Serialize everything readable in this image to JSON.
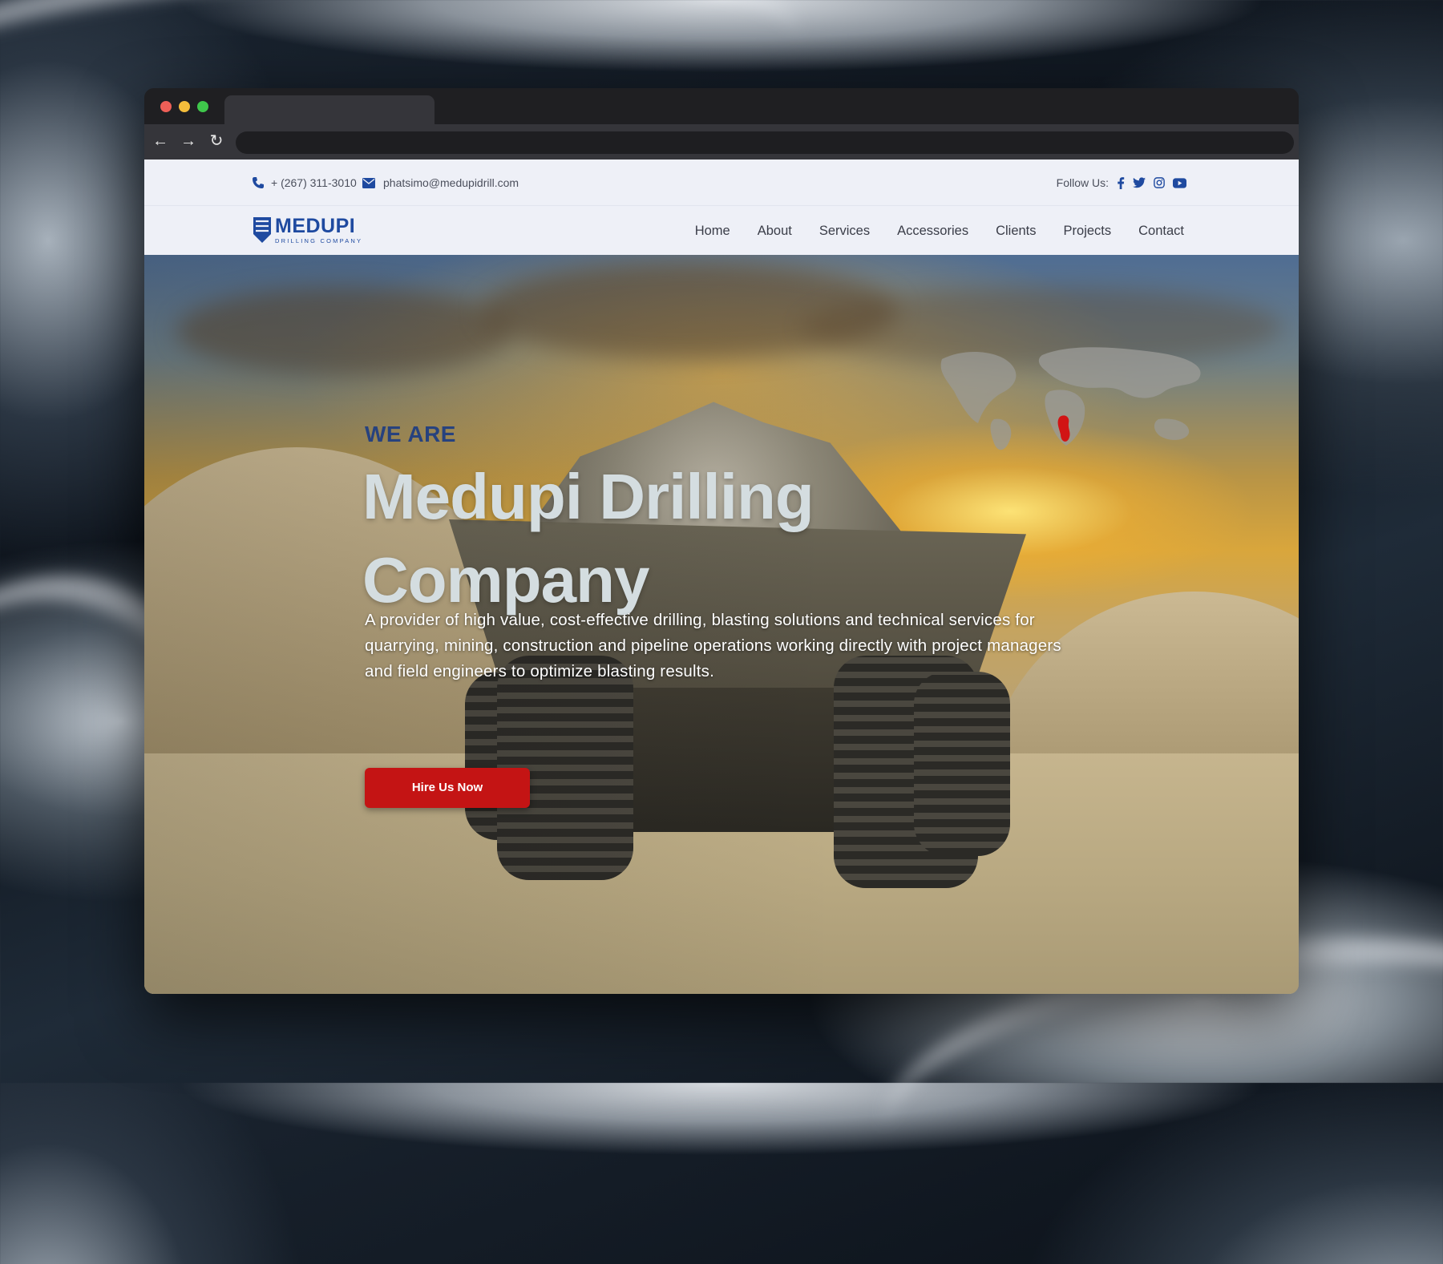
{
  "browser": {
    "back": "←",
    "forward": "→",
    "reload": "↻"
  },
  "contact": {
    "phone": "+ (267) 311-3010",
    "email": "phatsimo@medupidrill.com"
  },
  "social": {
    "label": "Follow Us:",
    "icons": [
      "facebook-icon",
      "twitter-icon",
      "instagram-icon",
      "youtube-icon"
    ]
  },
  "brand": {
    "name": "MEDUPI",
    "tagline": "DRILLING COMPANY",
    "color": "#1f4aa0"
  },
  "nav": {
    "items": [
      "Home",
      "About",
      "Services",
      "Accessories",
      "Clients",
      "Projects",
      "Contact"
    ]
  },
  "hero": {
    "eyebrow": "WE ARE",
    "title_line1": "Medupi Drilling",
    "title_line2": "Company",
    "description": "A provider of high value, cost-effective drilling, blasting solutions and technical services for quarrying, mining, construction and pipeline operations working directly with project managers and field engineers to optimize blasting results.",
    "cta": "Hire Us Now",
    "cta_color": "#c41414"
  }
}
